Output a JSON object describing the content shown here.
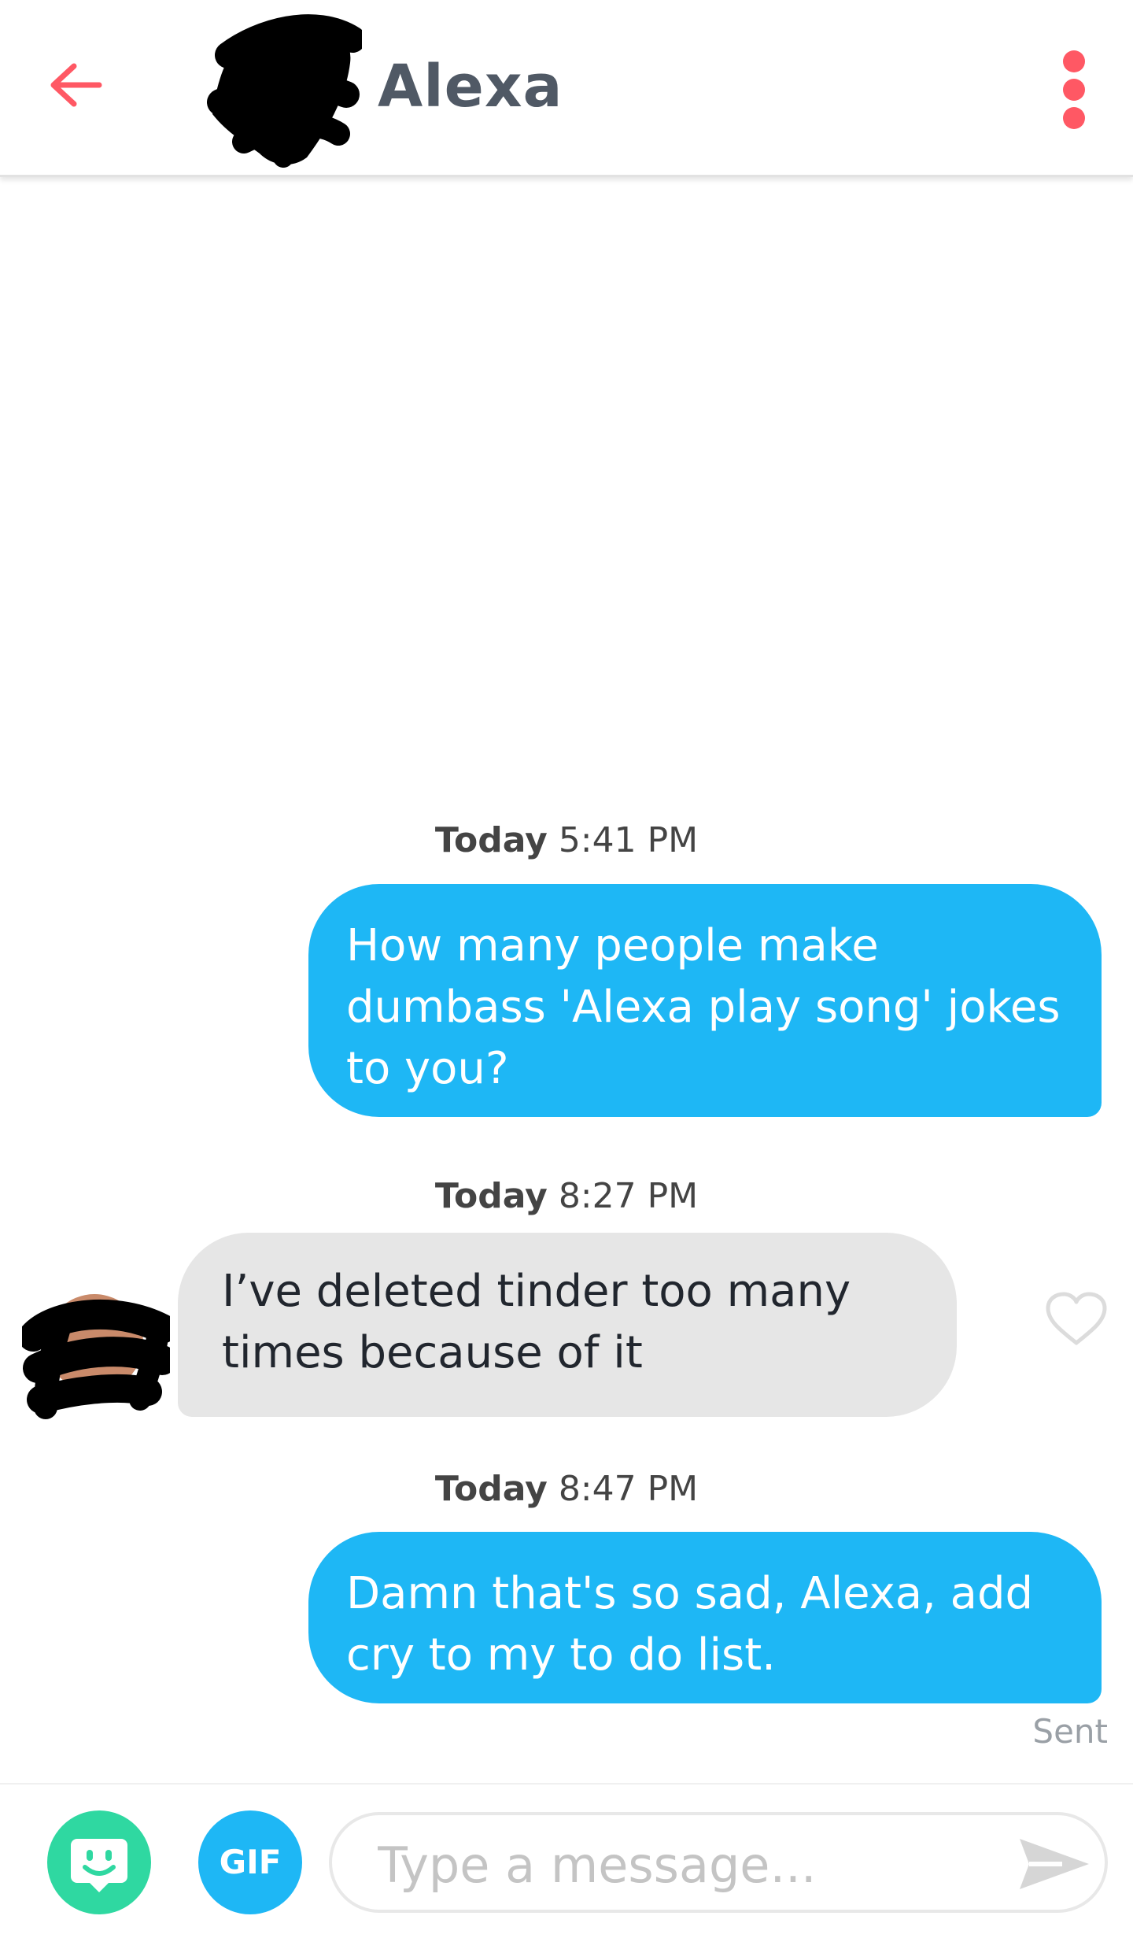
{
  "header": {
    "match_name": "Alexa",
    "icons": {
      "back": "arrow-left-icon",
      "menu": "vertical-dots-icon"
    },
    "accent_color": "#ff5864"
  },
  "messages": [
    {
      "timestamp_day": "Today",
      "timestamp_time": "5:41 PM",
      "direction": "sent",
      "lines": [
        "How many people make",
        "dumbass 'Alexa play song' jokes",
        "to you?"
      ]
    },
    {
      "timestamp_day": "Today",
      "timestamp_time": "8:27 PM",
      "direction": "received",
      "lines": [
        "I’ve deleted tinder too many",
        "times because of it"
      ]
    },
    {
      "timestamp_day": "Today",
      "timestamp_time": "8:47 PM",
      "direction": "sent",
      "lines": [
        "Damn that's so sad, Alexa, add",
        "cry to my to do list."
      ]
    }
  ],
  "status": {
    "sent_label": "Sent"
  },
  "composer": {
    "gif_label": "GIF",
    "placeholder": "Type a message...",
    "icons": {
      "sticker": "sticker-face-icon",
      "send": "send-arrow-icon"
    }
  },
  "colors": {
    "sent_bubble": "#1eb7f5",
    "received_bubble": "#e6e6e6",
    "sticker_button": "#2fd8a1",
    "gif_button": "#1eb7f5"
  }
}
